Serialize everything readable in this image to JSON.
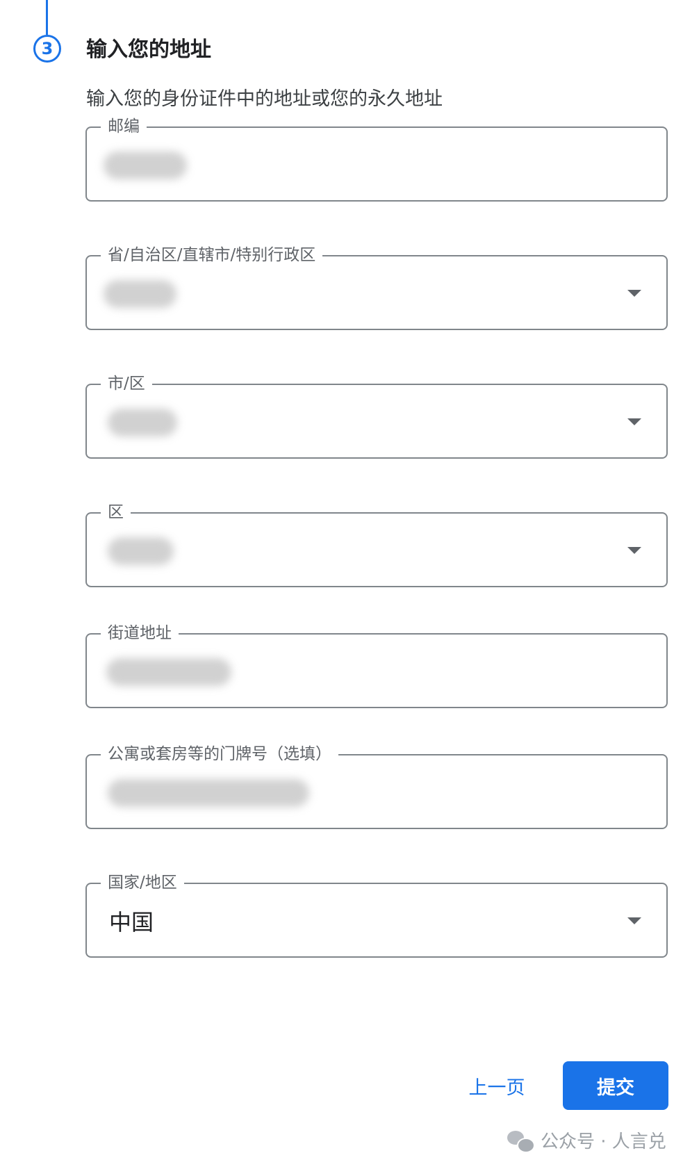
{
  "step": {
    "number": "3",
    "title": "输入您的地址",
    "subtitle": "输入您的身份证件中的地址或您的永久地址"
  },
  "fields": [
    {
      "label": "邮编",
      "type": "text",
      "value_hidden": true
    },
    {
      "label": "省/自治区/直辖市/特别行政区",
      "type": "select",
      "value_hidden": true
    },
    {
      "label": "市/区",
      "type": "select",
      "value_hidden": true
    },
    {
      "label": "区",
      "type": "select",
      "value_hidden": true
    },
    {
      "label": "街道地址",
      "type": "text",
      "value_hidden": true
    },
    {
      "label": "公寓或套房等的门牌号（选填）",
      "type": "text",
      "value_hidden": true
    },
    {
      "label": "国家/地区",
      "type": "select",
      "value": "中国"
    }
  ],
  "buttons": {
    "prev": "上一页",
    "submit": "提交"
  },
  "watermark": {
    "text": "公众号 · 人言兑",
    "icon": "wechat-icon"
  },
  "colors": {
    "accent": "#1a73e8",
    "border": "#80868b",
    "label": "#5f6368"
  }
}
